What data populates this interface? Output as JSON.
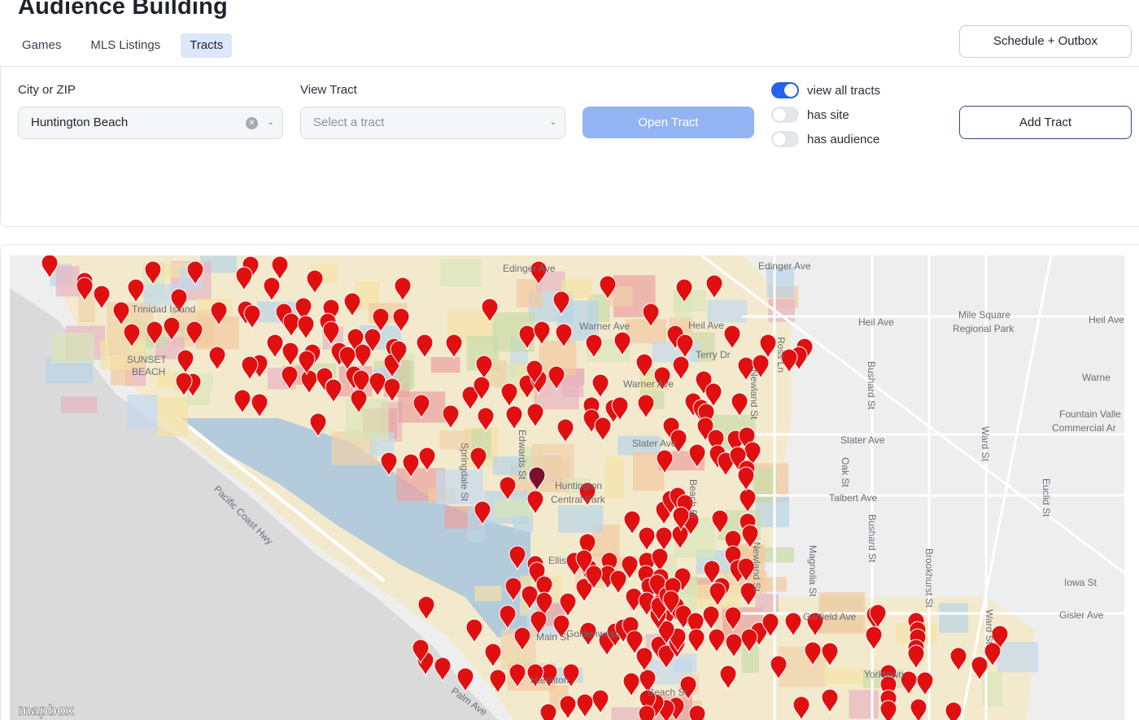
{
  "header": {
    "title": "Audience Building",
    "tabs": [
      {
        "label": "Games",
        "active": false
      },
      {
        "label": "MLS Listings",
        "active": false
      },
      {
        "label": "Tracts",
        "active": true
      }
    ],
    "schedule_button": "Schedule + Outbox"
  },
  "filters": {
    "city_label": "City or ZIP",
    "city_value": "Huntington Beach",
    "tract_label": "View Tract",
    "tract_placeholder": "Select a tract",
    "open_button": "Open Tract",
    "add_button": "Add Tract",
    "toggles": [
      {
        "label": "view all tracts",
        "on": true
      },
      {
        "label": "has site",
        "on": false
      },
      {
        "label": "has audience",
        "on": false
      }
    ]
  },
  "map": {
    "attribution": "mapbox",
    "labels": [
      "Edinger Ave",
      "Edinger Ave",
      "Heil Ave",
      "Heil Ave",
      "Heil Ave",
      "Mile Square",
      "Regional Park",
      "Warner Ave",
      "Warne",
      "Slater Ave",
      "Slater Ave",
      "Talbert Ave",
      "Fountain Valle",
      "Commercial Ar",
      "Iowa St",
      "Gisler Ave",
      "Terry Dr",
      "Pacific Coast Hwy",
      "Springdale St",
      "Edwards St",
      "Huntington",
      "Central Park",
      "Trinidad Island",
      "SUNSET",
      "BEACH",
      "Bushard St",
      "Bushard St",
      "Magnolia St",
      "Brookhurst St",
      "Ward St",
      "Ward St",
      "Oak St",
      "Euclid St",
      "Beach Bl",
      "Newland St",
      "Newland St",
      "Ellis",
      "Garfield Ave",
      "Yorktown",
      "Palm Ave",
      "Main St",
      "Ross Ln",
      "Goldenwest",
      "Hamilton",
      "Beach St",
      "Warner Ave"
    ],
    "marker_color": "#e01010",
    "selected_marker_color": "#7a0f2e"
  }
}
